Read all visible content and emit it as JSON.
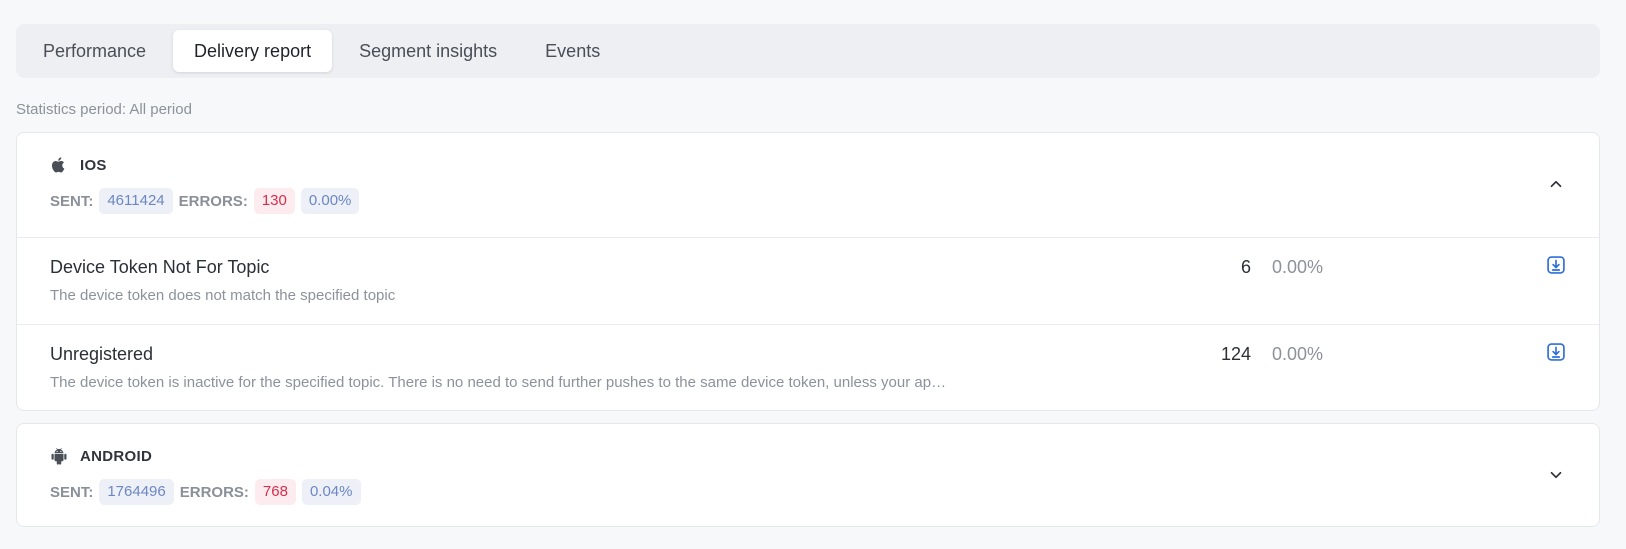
{
  "tabs": [
    {
      "label": "Performance",
      "active": false
    },
    {
      "label": "Delivery report",
      "active": true
    },
    {
      "label": "Segment insights",
      "active": false
    },
    {
      "label": "Events",
      "active": false
    }
  ],
  "period_text": "Statistics period: All period",
  "colors": {
    "accent_blue": "#6c87c4",
    "error_red": "#d62f4c",
    "download_icon": "#2f6fd6"
  },
  "platforms": {
    "ios": {
      "name": "IOS",
      "icon": "apple-icon",
      "sent_label": "SENT:",
      "sent": "4611424",
      "errors_label": "ERRORS:",
      "errors": "130",
      "rate": "0.00%",
      "expanded": true,
      "errors_list": [
        {
          "title": "Device Token Not For Topic",
          "description": "The device token does not match the specified topic",
          "count": "6",
          "percent": "0.00%"
        },
        {
          "title": "Unregistered",
          "description": "The device token is inactive for the specified topic. There is no need to send further pushes to the same device token, unless your ap…",
          "count": "124",
          "percent": "0.00%"
        }
      ]
    },
    "android": {
      "name": "ANDROID",
      "icon": "android-icon",
      "sent_label": "SENT:",
      "sent": "1764496",
      "errors_label": "ERRORS:",
      "errors": "768",
      "rate": "0.04%",
      "expanded": false
    }
  }
}
